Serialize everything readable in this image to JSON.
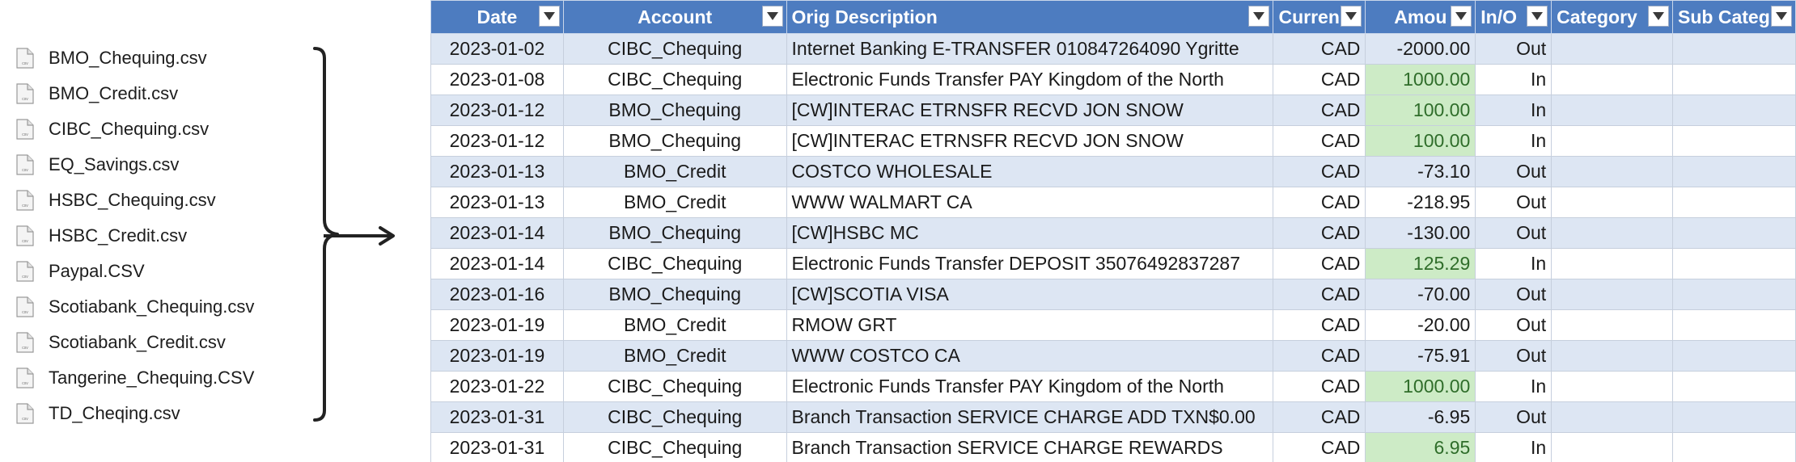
{
  "files": [
    "BMO_Chequing.csv",
    "BMO_Credit.csv",
    "CIBC_Chequing.csv",
    "EQ_Savings.csv",
    "HSBC_Chequing.csv",
    "HSBC_Credit.csv",
    "Paypal.CSV",
    "Scotiabank_Chequing.csv",
    "Scotiabank_Credit.csv",
    "Tangerine_Chequing.CSV",
    "TD_Cheqing.csv"
  ],
  "table": {
    "headers": [
      "Date",
      "Account",
      "Orig Description",
      "Curren",
      "Amou",
      "In/O",
      "Category",
      "Sub Categ"
    ],
    "rows": [
      {
        "date": "2023-01-02",
        "account": "CIBC_Chequing",
        "desc": "Internet Banking E-TRANSFER 010847264090 Ygritte",
        "currency": "CAD",
        "amount": "-2000.00",
        "inout": "Out",
        "positive": false
      },
      {
        "date": "2023-01-08",
        "account": "CIBC_Chequing",
        "desc": "Electronic Funds Transfer PAY Kingdom of the North",
        "currency": "CAD",
        "amount": "1000.00",
        "inout": "In",
        "positive": true
      },
      {
        "date": "2023-01-12",
        "account": "BMO_Chequing",
        "desc": "[CW]INTERAC ETRNSFR RECVD    JON SNOW",
        "currency": "CAD",
        "amount": "100.00",
        "inout": "In",
        "positive": true
      },
      {
        "date": "2023-01-12",
        "account": "BMO_Chequing",
        "desc": "[CW]INTERAC ETRNSFR RECVD    JON SNOW",
        "currency": "CAD",
        "amount": "100.00",
        "inout": "In",
        "positive": true
      },
      {
        "date": "2023-01-13",
        "account": "BMO_Credit",
        "desc": "COSTCO WHOLESALE",
        "currency": "CAD",
        "amount": "-73.10",
        "inout": "Out",
        "positive": false
      },
      {
        "date": "2023-01-13",
        "account": "BMO_Credit",
        "desc": "WWW WALMART CA",
        "currency": "CAD",
        "amount": "-218.95",
        "inout": "Out",
        "positive": false
      },
      {
        "date": "2023-01-14",
        "account": "BMO_Chequing",
        "desc": "[CW]HSBC MC",
        "currency": "CAD",
        "amount": "-130.00",
        "inout": "Out",
        "positive": false
      },
      {
        "date": "2023-01-14",
        "account": "CIBC_Chequing",
        "desc": "Electronic Funds Transfer DEPOSIT 35076492837287",
        "currency": "CAD",
        "amount": "125.29",
        "inout": "In",
        "positive": true
      },
      {
        "date": "2023-01-16",
        "account": "BMO_Chequing",
        "desc": "[CW]SCOTIA VISA",
        "currency": "CAD",
        "amount": "-70.00",
        "inout": "Out",
        "positive": false
      },
      {
        "date": "2023-01-19",
        "account": "BMO_Credit",
        "desc": "RMOW GRT",
        "currency": "CAD",
        "amount": "-20.00",
        "inout": "Out",
        "positive": false
      },
      {
        "date": "2023-01-19",
        "account": "BMO_Credit",
        "desc": "WWW COSTCO CA",
        "currency": "CAD",
        "amount": "-75.91",
        "inout": "Out",
        "positive": false
      },
      {
        "date": "2023-01-22",
        "account": "CIBC_Chequing",
        "desc": "Electronic Funds Transfer PAY Kingdom of the North",
        "currency": "CAD",
        "amount": "1000.00",
        "inout": "In",
        "positive": true
      },
      {
        "date": "2023-01-31",
        "account": "CIBC_Chequing",
        "desc": "Branch Transaction SERVICE CHARGE ADD TXN$0.00",
        "currency": "CAD",
        "amount": "-6.95",
        "inout": "Out",
        "positive": false
      },
      {
        "date": "2023-01-31",
        "account": "CIBC_Chequing",
        "desc": "Branch Transaction SERVICE CHARGE REWARDS",
        "currency": "CAD",
        "amount": "6.95",
        "inout": "In",
        "positive": true
      }
    ]
  },
  "colors": {
    "header_bg": "#4d7cc0",
    "band_row": "#dde6f3",
    "positive_amount_bg": "#cdebc6"
  }
}
